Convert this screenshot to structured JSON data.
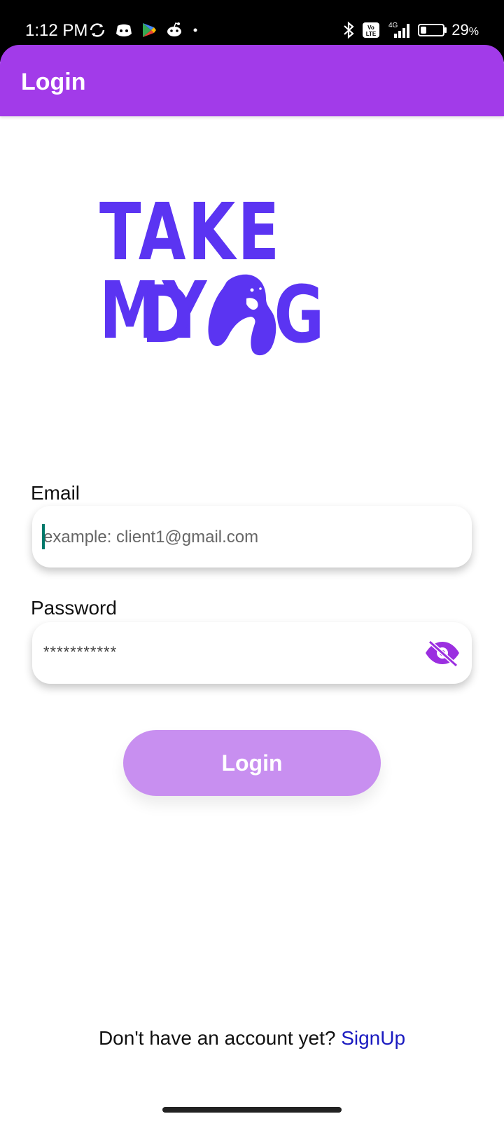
{
  "status_bar": {
    "time": "1:12 PM",
    "battery": "29",
    "battery_suffix": "%",
    "network": "4G",
    "volte": "Vo LTE",
    "icons_left": [
      "sync-icon",
      "discord-icon",
      "play-store-icon",
      "reddit-icon",
      "dot-icon"
    ],
    "icons_right": [
      "bluetooth-icon",
      "volte-icon",
      "signal-icon",
      "battery-icon"
    ]
  },
  "app_bar": {
    "title": "Login"
  },
  "logo": {
    "line1": "TAKE MY",
    "line2_left": "D",
    "line2_right": "G"
  },
  "form": {
    "email_label": "Email",
    "email_placeholder": "example: client1@gmail.com",
    "password_label": "Password",
    "password_mask": "***********",
    "eye_icon": "eye-off-icon"
  },
  "login_button": {
    "label": "Login"
  },
  "footer": {
    "prompt": "Don't have an account yet?",
    "signup_link": "SignUp"
  },
  "colors": {
    "app_bar": "#a23be9",
    "brand": "#5b34f2",
    "button": "#c88ff0",
    "link": "#1a1ac0",
    "eye": "#9b2fe0"
  }
}
